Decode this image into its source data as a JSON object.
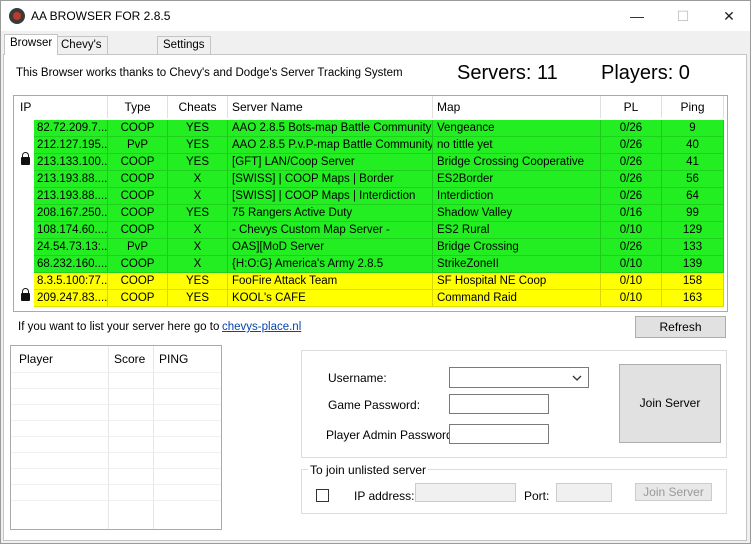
{
  "window": {
    "title": "AA BROWSER FOR 2.8.5",
    "min_glyph": "—",
    "max_glyph": "☐",
    "close_glyph": "✕"
  },
  "tabs": [
    {
      "label": "Browser",
      "active": true
    },
    {
      "label": "Chevy's Shout Box",
      "active": false
    },
    {
      "label": "Settings",
      "active": false
    }
  ],
  "notice": "This Browser works thanks to Chevy's  and Dodge's Server Tracking System",
  "stats": {
    "servers": "Servers: 11",
    "players": "Players: 0"
  },
  "colors": {
    "green": "#22ee22",
    "yellow": "#ffff00",
    "link": "#0645ad"
  },
  "grid": {
    "columns": [
      "IP",
      "Type",
      "Cheats",
      "Server Name",
      "Map",
      "PL",
      "Ping"
    ],
    "rows": [
      {
        "ip": "82.72.209.7...",
        "type": "COOP",
        "cheats": "YES",
        "name": "AAO 2.8.5 Bots-map Battle Community",
        "map": "Vengeance",
        "pl": "0/26",
        "ping": "9",
        "color": "green",
        "locked": false
      },
      {
        "ip": "212.127.195...",
        "type": "PvP",
        "cheats": "YES",
        "name": "AAO 2.8.5 P.v.P-map Battle Community",
        "map": "no tittle yet",
        "pl": "0/26",
        "ping": "40",
        "color": "green",
        "locked": false
      },
      {
        "ip": "213.133.100...",
        "type": "COOP",
        "cheats": "YES",
        "name": "[GFT] LAN/Coop Server",
        "map": "Bridge Crossing Cooperative",
        "pl": "0/26",
        "ping": "41",
        "color": "green",
        "locked": true
      },
      {
        "ip": "213.193.88....",
        "type": "COOP",
        "cheats": "X",
        "name": "[SWISS] | COOP Maps | Border",
        "map": "ES2Border",
        "pl": "0/26",
        "ping": "56",
        "color": "green",
        "locked": false
      },
      {
        "ip": "213.193.88....",
        "type": "COOP",
        "cheats": "X",
        "name": "[SWISS] | COOP Maps | Interdiction",
        "map": "Interdiction",
        "pl": "0/26",
        "ping": "64",
        "color": "green",
        "locked": false
      },
      {
        "ip": "208.167.250...",
        "type": "COOP",
        "cheats": "YES",
        "name": "75 Rangers Active Duty",
        "map": "Shadow Valley",
        "pl": "0/16",
        "ping": "99",
        "color": "green",
        "locked": false
      },
      {
        "ip": "108.174.60....",
        "type": "COOP",
        "cheats": "X",
        "name": " - Chevys Custom Map Server -",
        "map": "ES2 Rural",
        "pl": "0/10",
        "ping": "129",
        "color": "green",
        "locked": false
      },
      {
        "ip": "24.54.73.13:...",
        "type": "PvP",
        "cheats": "X",
        "name": "OAS][MoD Server",
        "map": "Bridge Crossing",
        "pl": "0/26",
        "ping": "133",
        "color": "green",
        "locked": false
      },
      {
        "ip": "68.232.160....",
        "type": "COOP",
        "cheats": "X",
        "name": "{H:O:G} America's Army 2.8.5",
        "map": "StrikeZoneII",
        "pl": "0/10",
        "ping": "139",
        "color": "green",
        "locked": false
      },
      {
        "ip": "8.3.5.100:77...",
        "type": "COOP",
        "cheats": "YES",
        "name": "FooFire Attack Team",
        "map": "SF Hospital NE Coop",
        "pl": "0/10",
        "ping": "158",
        "color": "yellow",
        "locked": false
      },
      {
        "ip": "209.247.83....",
        "type": "COOP",
        "cheats": "YES",
        "name": "KOOL's CAFE",
        "map": "Command Raid",
        "pl": "0/10",
        "ping": "163",
        "color": "yellow",
        "locked": true
      }
    ]
  },
  "list_text": "If you want to list your server here go to",
  "list_link": "chevys-place.nl",
  "refresh_label": "Refresh",
  "players_table": {
    "columns": [
      "Player",
      "Score",
      "PING"
    ]
  },
  "login": {
    "username_label": "Username:",
    "username_value": "",
    "game_password_label": "Game Password:",
    "admin_password_label": "Player Admin Password:",
    "join_label": "Join Server"
  },
  "unlisted": {
    "legend": "To join unlisted server",
    "ip_label": "IP address:",
    "port_label": "Port:",
    "join_label": "Join Server"
  }
}
